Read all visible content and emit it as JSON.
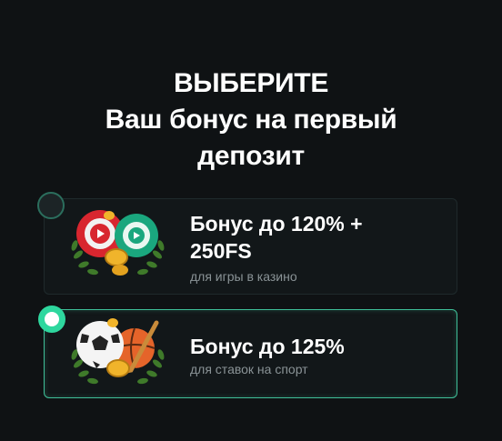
{
  "heading": {
    "line1": "ВЫБЕРИТЕ",
    "line2": "Ваш бонус на первый",
    "line3": "депозит"
  },
  "bonuses": [
    {
      "title_line1": "Бонус до 120% +",
      "title_line2": "250FS",
      "subtitle": "для игры в казино",
      "selected": false,
      "icon": "casino-chips-icon"
    },
    {
      "title_line1": "Бонус до 125%",
      "subtitle": "для ставок на спорт",
      "selected": true,
      "icon": "sports-balls-icon"
    }
  ],
  "colors": {
    "background": "#0f1214",
    "card": "#121719",
    "accent": "#2ed79e",
    "subtitle": "#8a9396"
  }
}
